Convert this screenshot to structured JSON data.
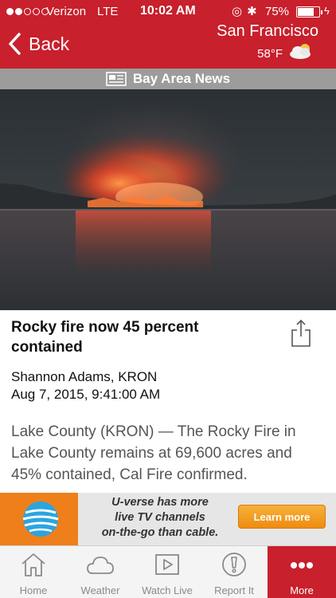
{
  "status_bar": {
    "carrier": "Verizon",
    "network": "LTE",
    "time": "10:02 AM",
    "battery_percent": "75%",
    "battery_level": 0.75
  },
  "nav": {
    "back_label": "Back",
    "city": "San Francisco",
    "temperature": "58°F",
    "weather_icon": "partly-cloudy-icon"
  },
  "section": {
    "label": "Bay Area News",
    "icon": "newspaper-icon"
  },
  "article": {
    "title": "Rocky fire now 45 percent contained",
    "author": "Shannon Adams, KRON",
    "date": "Aug 7, 2015, 9:41:00 AM",
    "body": "Lake County (KRON)  — The Rocky Fire in Lake County remains at 69,600 acres and 45% contained, Cal Fire confirmed."
  },
  "ad": {
    "line1": "U-verse has more",
    "line2": "live TV channels",
    "line3": "on-the-go than cable.",
    "cta": "Learn more"
  },
  "tabs": [
    {
      "label": "Home",
      "icon": "home-icon"
    },
    {
      "label": "Weather",
      "icon": "cloud-icon"
    },
    {
      "label": "Watch Live",
      "icon": "play-icon"
    },
    {
      "label": "Report It",
      "icon": "alert-icon"
    },
    {
      "label": "More",
      "icon": "more-icon"
    }
  ],
  "colors": {
    "brand_red": "#c8202c",
    "section_gray": "#9c9c9c",
    "ad_orange": "#ef7f1a"
  }
}
